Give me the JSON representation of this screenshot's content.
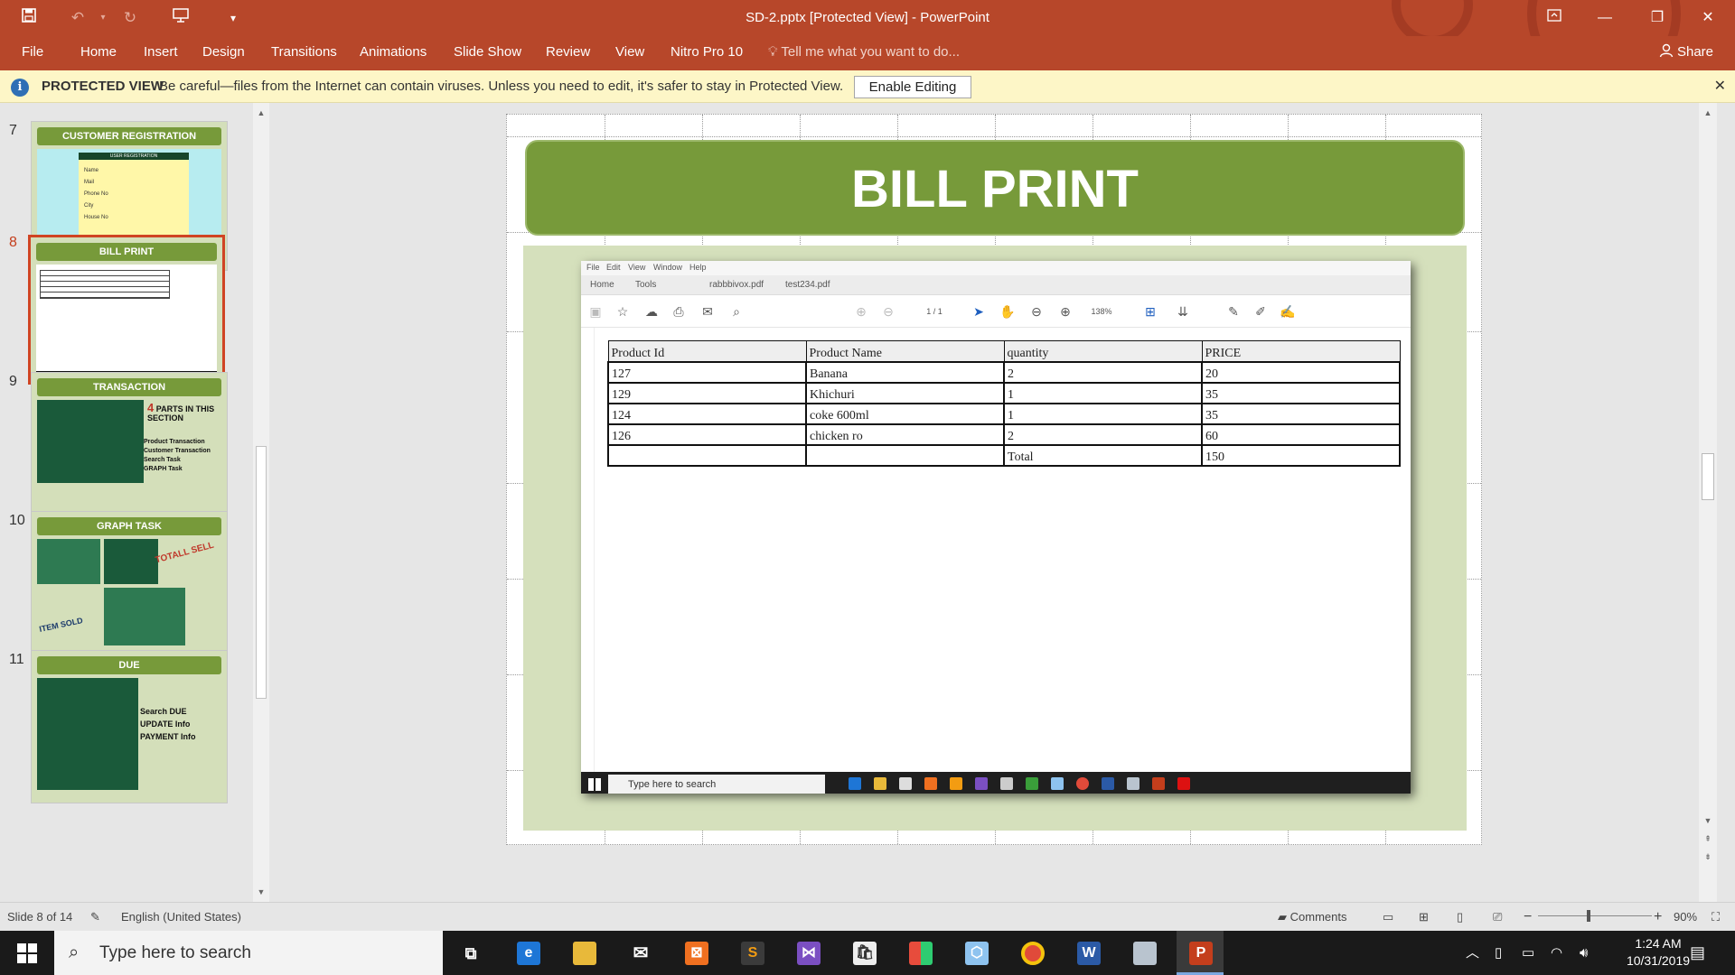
{
  "window": {
    "title": "SD-2.pptx [Protected View] - PowerPoint"
  },
  "menu": {
    "file": "File",
    "tabs": [
      "Home",
      "Insert",
      "Design",
      "Transitions",
      "Animations",
      "Slide Show",
      "Review",
      "View",
      "Nitro Pro 10"
    ],
    "tell_me": "Tell me what you want to do...",
    "share": "Share"
  },
  "protected_view": {
    "label": "PROTECTED VIEW",
    "message": "Be careful—files from the Internet can contain viruses. Unless you need to edit, it's safer to stay in Protected View.",
    "button": "Enable Editing"
  },
  "thumbnails": [
    {
      "num": "7",
      "title": "CUSTOMER REGISTRATION",
      "active": false
    },
    {
      "num": "8",
      "title": "BILL PRINT",
      "active": true
    },
    {
      "num": "9",
      "title": "TRANSACTION",
      "active": false
    },
    {
      "num": "10",
      "title": "GRAPH TASK",
      "active": false
    },
    {
      "num": "11",
      "title": "DUE",
      "active": false
    }
  ],
  "thumb_details": {
    "t7_sub": "USER REGISTRATION",
    "t7_fields": [
      "Name",
      "Mail",
      "Phone No",
      "City",
      "House No"
    ],
    "t9_count": "4",
    "t9_text": "PARTS IN THIS SECTION",
    "t9_items": [
      "Product Transaction",
      "Customer Transaction",
      "Search Task",
      "GRAPH Task"
    ],
    "t10_a": "TOTALL SELL",
    "t10_b": "ITEM SOLD",
    "t11_items": [
      "Search DUE",
      "UPDATE Info",
      "PAYMENT Info"
    ]
  },
  "slide": {
    "title": "BILL PRINT",
    "screenshot": {
      "menu": [
        "File",
        "Edit",
        "View",
        "Window",
        "Help"
      ],
      "tabs": [
        "Home",
        "Tools",
        "rabbbivox.pdf",
        "test234.pdf"
      ],
      "page": "1 / 1",
      "zoom": "138%",
      "table": {
        "headers": [
          "Product Id",
          "Product Name",
          "quantity",
          "PRICE"
        ],
        "rows": [
          [
            "127",
            "Banana",
            "2",
            "20"
          ],
          [
            "129",
            "Khichuri",
            "1",
            "35"
          ],
          [
            "124",
            "coke 600ml",
            "1",
            "35"
          ],
          [
            "126",
            "chicken ro",
            "2",
            "60"
          ],
          [
            "",
            "",
            "Total",
            "150"
          ]
        ]
      },
      "search_placeholder": "Type here to search"
    }
  },
  "status": {
    "slide_info": "Slide 8 of 14",
    "language": "English (United States)",
    "comments": "Comments",
    "zoom": "90%"
  },
  "taskbar": {
    "search_placeholder": "Type here to search",
    "time": "1:24 AM",
    "date": "10/31/2019"
  }
}
